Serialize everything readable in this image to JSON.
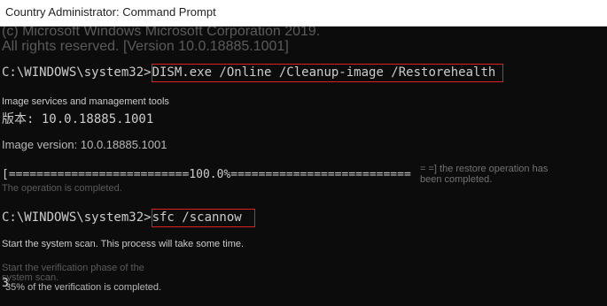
{
  "window": {
    "title": "Country Administrator: Command Prompt"
  },
  "console": {
    "header_line1": "(c) Microsoft Windows Microsoft Corporation 2019.",
    "header_line2": "All rights reserved. [Version 10.0.18885.1001]",
    "prompt1": "C:\\WINDOWS\\system32>",
    "cmd1": "DISM.exe /Online /Cleanup-image /Restorehealth",
    "tool_line": "Image services and management tools",
    "version_cn": "版本: 10.0.18885.1001",
    "image_version": "Image version: 10.0.18885.1001",
    "progress": "[==========================100.0%==========================",
    "progress_note": "= =] the restore operation has been completed.",
    "op_completed": "The operation is completed.",
    "prompt2": "C:\\WINDOWS\\system32>",
    "cmd2": "sfc /scannow",
    "scan_start": "Start the system scan. This process will take some time.",
    "verify_phase_1": "Start the verification phase of the",
    "verify_phase_2": "system scan.",
    "verify_pct": "35% of the verification is completed.",
    "cursor_text": "3"
  },
  "colors": {
    "console_bg": "#0c0c0c",
    "console_text": "#cccccc",
    "highlight_box": "#e02020",
    "titlebar_bg": "#ffffff"
  }
}
